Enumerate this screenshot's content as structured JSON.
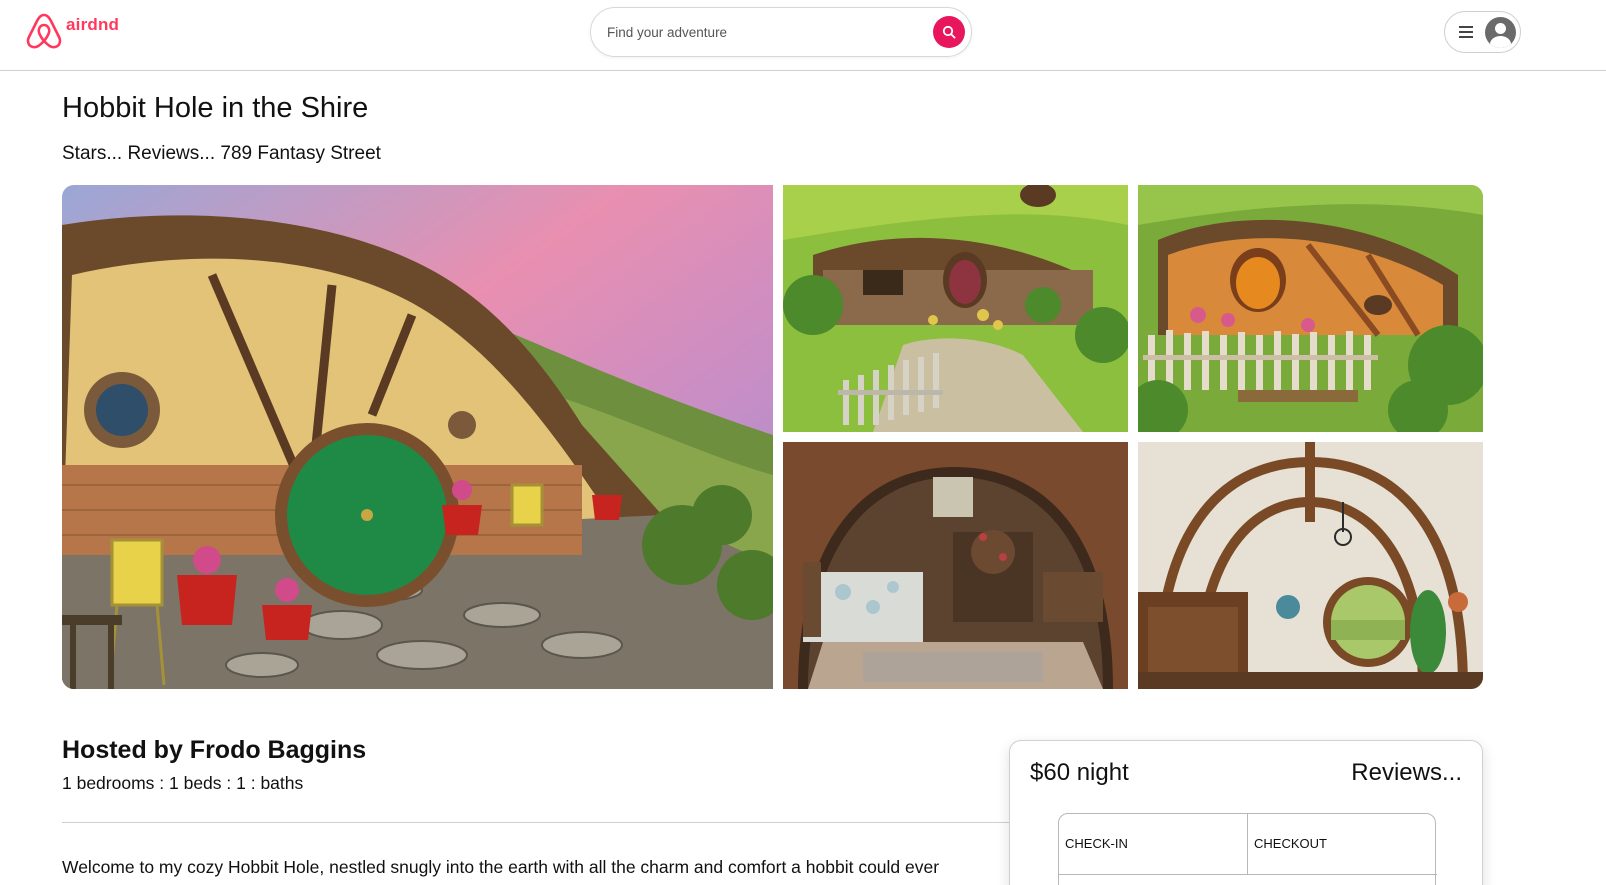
{
  "brand": {
    "name": "airdnd",
    "color": "#ff385c",
    "logo_icon": "airbnb-belo-icon"
  },
  "search": {
    "placeholder": "Find your adventure",
    "button_icon": "search-icon",
    "button_color": "#e8175d"
  },
  "user_menu": {
    "menu_icon": "hamburger-icon",
    "avatar_icon": "user-avatar-icon"
  },
  "listing": {
    "title": "Hobbit Hole in the Shire",
    "subtitle": "Stars... Reviews... 789 Fantasy Street"
  },
  "gallery": {
    "photos": [
      {
        "subject": "hobbit-hole-exterior-sunset"
      },
      {
        "subject": "hobbit-hole-garden-path"
      },
      {
        "subject": "hobbit-hole-orange-door"
      },
      {
        "subject": "hobbit-hole-bedroom"
      },
      {
        "subject": "hobbit-hole-round-window-interior"
      }
    ]
  },
  "host": {
    "title": "Hosted by Frodo Baggins",
    "details": "1 bedrooms : 1 beds : 1 : baths"
  },
  "description": "Welcome to my cozy Hobbit Hole, nestled snugly into the earth with all the charm and comfort a hobbit could ever",
  "booking": {
    "price": "$60 night",
    "reviews": "Reviews...",
    "checkin_label": "CHECK-IN",
    "checkout_label": "CHECKOUT"
  }
}
